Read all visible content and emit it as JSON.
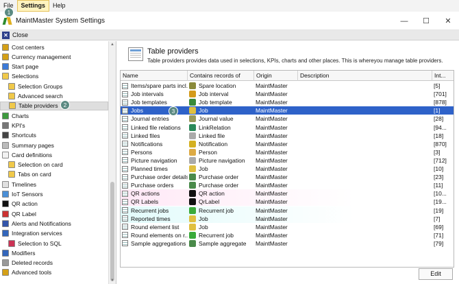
{
  "menu": {
    "items": [
      "File",
      "Settings",
      "Help"
    ]
  },
  "window": {
    "title": "MaintMaster System Settings",
    "minimize": "—",
    "maximize": "☐",
    "close": "✕"
  },
  "closebar": {
    "label": "Close"
  },
  "sidebar": {
    "items": [
      {
        "label": "Cost centers",
        "icon": "coins-icon",
        "color": "#d4a017"
      },
      {
        "label": "Currency management",
        "icon": "coins-icon",
        "color": "#d4a017"
      },
      {
        "label": "Start page",
        "icon": "start-page-icon",
        "color": "#3c7ad8"
      },
      {
        "label": "Selections",
        "icon": "folder-icon",
        "color": "#f0c94a"
      },
      {
        "label": "Selection Groups",
        "icon": "folder-icon",
        "color": "#f0c94a"
      },
      {
        "label": "Advanced search",
        "icon": "folder-icon",
        "color": "#f0c94a"
      },
      {
        "label": "Table providers",
        "icon": "folder-icon",
        "color": "#f0c94a"
      },
      {
        "label": "Charts",
        "icon": "chart-icon",
        "color": "#3d9a3d"
      },
      {
        "label": "KPI's",
        "icon": "gauge-icon",
        "color": "#777777"
      },
      {
        "label": "Shortcuts",
        "icon": "shortcut-icon",
        "color": "#444444"
      },
      {
        "label": "Summary pages",
        "icon": "summary-page-icon",
        "color": "#bbbbbb"
      },
      {
        "label": "Card definitions",
        "icon": "card-icon",
        "color": "#f2f2f2"
      },
      {
        "label": "Selection on card",
        "icon": "folder-icon",
        "color": "#f0c94a"
      },
      {
        "label": "Tabs on card",
        "icon": "folder-icon",
        "color": "#f0c94a"
      },
      {
        "label": "Timelines",
        "icon": "timeline-icon",
        "color": "#e0e0e0"
      },
      {
        "label": "IoT Sensors",
        "icon": "sensor-icon",
        "color": "#4a8fd6"
      },
      {
        "label": "QR action",
        "icon": "qr-icon",
        "color": "#111111"
      },
      {
        "label": "QR Label",
        "icon": "qr-label-icon",
        "color": "#cc3333"
      },
      {
        "label": "Alerts and Notifications",
        "icon": "alert-icon",
        "color": "#3355aa"
      },
      {
        "label": "Integration services",
        "icon": "integration-icon",
        "color": "#3366bb"
      },
      {
        "label": "Selection to SQL",
        "icon": "sql-icon",
        "color": "#cc3355"
      },
      {
        "label": "Modifiers",
        "icon": "modifier-icon",
        "color": "#3366bb"
      },
      {
        "label": "Deleted records",
        "icon": "deleted-records-icon",
        "color": "#999999"
      },
      {
        "label": "Advanced tools",
        "icon": "tools-icon",
        "color": "#d4a017"
      }
    ],
    "selected": "Table providers"
  },
  "main": {
    "title": "Table providers",
    "description": "Table providers provides data used in selections, KPIs, charts and other places. This is whereyou manage table providers."
  },
  "grid": {
    "columns": [
      "Name",
      "Contains records of",
      "Origin",
      "Description",
      "Int..."
    ],
    "rows": [
      {
        "name": "Items/spare parts incl...",
        "records": "Spare location",
        "origin": "MaintMaster",
        "description": "",
        "int": "[5]",
        "rec_color": "#8a8a3a"
      },
      {
        "name": "Job intervals",
        "records": "Job interval",
        "origin": "MaintMaster",
        "description": "",
        "int": "[701]",
        "rec_color": "#d49a1a"
      },
      {
        "name": "Job templates",
        "records": "Job template",
        "origin": "MaintMaster",
        "description": "",
        "int": "[878]",
        "rec_color": "#3a8a3a"
      },
      {
        "name": "Jobs",
        "records": "Job",
        "origin": "MaintMaster",
        "description": "",
        "int": "[1]",
        "rec_color": "#e0c040"
      },
      {
        "name": "Journal entries",
        "records": "Journal value",
        "origin": "MaintMaster",
        "description": "",
        "int": "[28]",
        "rec_color": "#9a9a5a"
      },
      {
        "name": "Linked file relations",
        "records": "LinkRelation",
        "origin": "MaintMaster",
        "description": "",
        "int": "[94...",
        "rec_color": "#2a8a5a"
      },
      {
        "name": "Linked files",
        "records": "Linked file",
        "origin": "MaintMaster",
        "description": "",
        "int": "[18]",
        "rec_color": "#aaaaaa"
      },
      {
        "name": "Notifications",
        "records": "Notification",
        "origin": "MaintMaster",
        "description": "",
        "int": "[870]",
        "rec_color": "#d4b020"
      },
      {
        "name": "Persons",
        "records": "Person",
        "origin": "MaintMaster",
        "description": "",
        "int": "[3]",
        "rec_color": "#ddaa44"
      },
      {
        "name": "Picture navigation",
        "records": "Picture navigation",
        "origin": "MaintMaster",
        "description": "",
        "int": "[712]",
        "rec_color": "#aaaaaa"
      },
      {
        "name": "Planned times",
        "records": "Job",
        "origin": "MaintMaster",
        "description": "",
        "int": "[10]",
        "rec_color": "#e0c040"
      },
      {
        "name": "Purchase order details",
        "records": "Purchase order",
        "origin": "MaintMaster",
        "description": "",
        "int": "[23]",
        "rec_color": "#4a8a4a"
      },
      {
        "name": "Purchase orders",
        "records": "Purchase order",
        "origin": "MaintMaster",
        "description": "",
        "int": "[11]",
        "rec_color": "#4a8a4a"
      },
      {
        "name": "QR actions",
        "records": "QR action",
        "origin": "MaintMaster",
        "description": "",
        "int": "[10...",
        "rec_color": "#111111"
      },
      {
        "name": "QR Labels",
        "records": "QrLabel",
        "origin": "MaintMaster",
        "description": "",
        "int": "[19...",
        "rec_color": "#111111"
      },
      {
        "name": "Recurrent jobs",
        "records": "Recurrent job",
        "origin": "MaintMaster",
        "description": "",
        "int": "[19]",
        "rec_color": "#3aaa3a"
      },
      {
        "name": "Reported times",
        "records": "Job",
        "origin": "MaintMaster",
        "description": "",
        "int": "[7]",
        "rec_color": "#e0c040"
      },
      {
        "name": "Round element list",
        "records": "Job",
        "origin": "MaintMaster",
        "description": "",
        "int": "[69]",
        "rec_color": "#e0c040"
      },
      {
        "name": "Round elements on r...",
        "records": "Recurrent job",
        "origin": "MaintMaster",
        "description": "",
        "int": "[71]",
        "rec_color": "#3aaa3a"
      },
      {
        "name": "Sample aggregations",
        "records": "Sample aggregate",
        "origin": "MaintMaster",
        "description": "",
        "int": "[79]",
        "rec_color": "#4a8a4a"
      }
    ],
    "selected_row": "Jobs"
  },
  "buttons": {
    "edit": "Edit"
  },
  "steps": [
    "1",
    "2",
    "3"
  ],
  "colors": {
    "selection": "#2e62c9",
    "menu_active": "#fff3bf"
  }
}
